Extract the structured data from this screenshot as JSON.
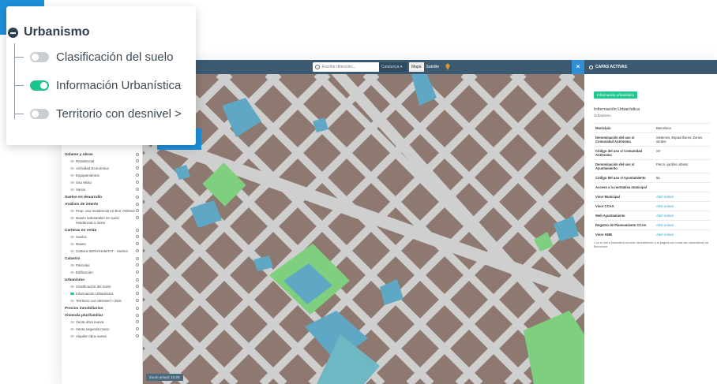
{
  "zoom": {
    "title": "Urbanismo",
    "items": [
      {
        "label": "Clasificación del suelo",
        "on": false
      },
      {
        "label": "Información Urbanística",
        "on": true
      },
      {
        "label": "Territorio con desnivel >",
        "on": false
      }
    ]
  },
  "topbar": {
    "search_placeholder": "Escribe dirección...",
    "region_select": "Catalunya",
    "map_mode": "Mapa",
    "sat_mode": "Satélite"
  },
  "left_sidebar": {
    "sections": [
      {
        "title": "Solares y obras",
        "items": [
          {
            "label": "Residencial",
            "on": false
          },
          {
            "label": "Actividad Económica",
            "on": false
          },
          {
            "label": "Equipamientos",
            "on": false
          },
          {
            "label": "Uso Mixto",
            "on": false
          },
          {
            "label": "Varios",
            "on": false
          }
        ]
      },
      {
        "title": "Suelos en desarrollo",
        "items": []
      },
      {
        "title": "Análisis de interés",
        "items": [
          {
            "label": "Prop. uso residencial en Bcn >600m2",
            "on": false
          },
          {
            "label": "Naves industriales en suelo residencial o mixto",
            "on": false
          }
        ]
      },
      {
        "title": "Carteras en venta",
        "items": [
          {
            "label": "Suelos",
            "on": false
          },
          {
            "label": "Naves",
            "on": false
          },
          {
            "label": "Cartera SERVIHABITAT - Suelos",
            "on": false
          }
        ]
      },
      {
        "title": "Catastro",
        "items": [
          {
            "label": "Parcelas",
            "on": false
          },
          {
            "label": "Edificación",
            "on": false
          }
        ]
      },
      {
        "title": "Urbanismo",
        "items": [
          {
            "label": "Clasificación del suelo",
            "on": false
          },
          {
            "label": "Información Urbanística",
            "on": true
          },
          {
            "label": "Territorio con desnivel > 25%",
            "on": false
          }
        ]
      },
      {
        "title": "Precios inmobiliarios",
        "items": []
      },
      {
        "title": "Vivienda plurifamiliar",
        "items": [
          {
            "label": "Venta obra nueva",
            "on": false
          },
          {
            "label": "Venta segunda mano",
            "on": false
          },
          {
            "label": "Alquiler obra nueva",
            "on": false
          }
        ]
      }
    ]
  },
  "map": {
    "scale_label": "Zoom actual: 15.25"
  },
  "right_panel": {
    "header": "CAPAS ACTIVAS",
    "close_icon": "×",
    "badge": "Información urbanística",
    "title": "Información Urbanística",
    "subtitle": "Urbanismo",
    "rows": [
      {
        "k": "Municipio",
        "v": "Barcelona",
        "link": false
      },
      {
        "k": "Denominación del uso s/ Comunidad Autónoma",
        "v": "Sistemes, Espais lliures, Zones verdes",
        "link": false
      },
      {
        "k": "Código del uso s/ Comunidad Autónoma",
        "v": "SV",
        "link": false
      },
      {
        "k": "Denominación del uso s/ Ayuntamiento",
        "v": "Parcs i jardins urbans",
        "link": false
      },
      {
        "k": "Código del uso s/ Ayuntamiento",
        "v": "6a",
        "link": false
      },
      {
        "k": "Acceso a la normativa municipal",
        "v": "",
        "link": false
      },
      {
        "k": "Visor Municipal",
        "v": "Abrir enlace",
        "link": true
      },
      {
        "k": "Visor CCAA",
        "v": "Abrir enlace",
        "link": true
      },
      {
        "k": "Web Ayuntamiento",
        "v": "Abrir enlace",
        "link": true
      },
      {
        "k": "Registro de Planeamiento CCAA",
        "v": "Abrir enlace",
        "link": true
      },
      {
        "k": "Visor AMB",
        "v": "Abrir enlace",
        "link": true
      }
    ],
    "footnote": "Con el link a Normativa accede directamente a la página con todas las urbanísticas de Barcelona"
  },
  "colors": {
    "accent": "#1d8fd8",
    "toggle_on": "#1ec28b",
    "topbar": "#3b5a72",
    "map_block": "#8d7970",
    "map_street": "#cfcfcf",
    "park": "#7fd07e",
    "equipment": "#5ea8c5"
  }
}
